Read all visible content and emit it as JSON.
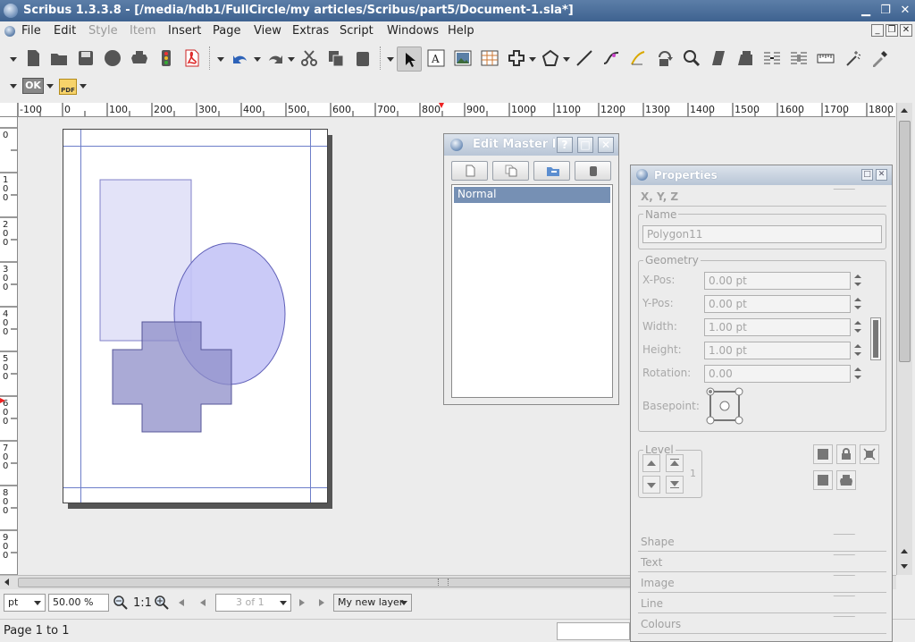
{
  "window": {
    "title": "Scribus 1.3.3.8 - [/media/hdb1/FullCircle/my articles/Scribus/part5/Document-1.sla*]"
  },
  "menubar": {
    "items": [
      {
        "label": "File",
        "enabled": true
      },
      {
        "label": "Edit",
        "enabled": true
      },
      {
        "label": "Style",
        "enabled": false
      },
      {
        "label": "Item",
        "enabled": false
      },
      {
        "label": "Insert",
        "enabled": true
      },
      {
        "label": "Page",
        "enabled": true
      },
      {
        "label": "View",
        "enabled": true
      },
      {
        "label": "Extras",
        "enabled": true
      },
      {
        "label": "Script",
        "enabled": true
      },
      {
        "label": "Windows",
        "enabled": true
      },
      {
        "label": "Help",
        "enabled": true
      }
    ]
  },
  "toolbar2": {
    "ok_label": "OK",
    "pdf_label": "PDF"
  },
  "ruler": {
    "h_ticks": [
      "-100",
      "0",
      "100",
      "200",
      "300",
      "400",
      "500",
      "600",
      "700",
      "800",
      "900",
      "1000",
      "1100",
      "1200",
      "1300",
      "1400",
      "1500",
      "1600",
      "1700",
      "1800"
    ],
    "v_ticks": [
      "0",
      "100",
      "200",
      "300",
      "400",
      "500",
      "600",
      "700",
      "800",
      "900"
    ]
  },
  "master_pages": {
    "title": "Edit Master Pages",
    "items": [
      "Normal"
    ]
  },
  "properties": {
    "title": "Properties",
    "tab_xyz": "X, Y, Z",
    "name_label": "Name",
    "name_value": "Polygon11",
    "geometry_label": "Geometry",
    "xpos_label": "X-Pos:",
    "xpos_value": "0.00 pt",
    "ypos_label": "Y-Pos:",
    "ypos_value": "0.00 pt",
    "width_label": "Width:",
    "width_value": "1.00 pt",
    "height_label": "Height:",
    "height_value": "1.00 pt",
    "rotation_label": "Rotation:",
    "rotation_value": "0.00",
    "basepoint_label": "Basepoint:",
    "level_label": "Level",
    "level_value": "1",
    "tabs": [
      "Shape",
      "Text",
      "Image",
      "Line",
      "Colours"
    ]
  },
  "bottombar": {
    "unit": "pt",
    "zoom": "50.00 %",
    "ratio": "1:1",
    "page_select": "3 of 1",
    "layer": "My new layer"
  },
  "status": {
    "text": "Page 1 to 1"
  },
  "colors": {
    "title_bar": "#4a6d99",
    "selection": "#7690b4",
    "rect_fill": "#e3e3f8",
    "ellipse_fill": "#c4c4f6",
    "cross_fill": "#8e8ec8"
  }
}
